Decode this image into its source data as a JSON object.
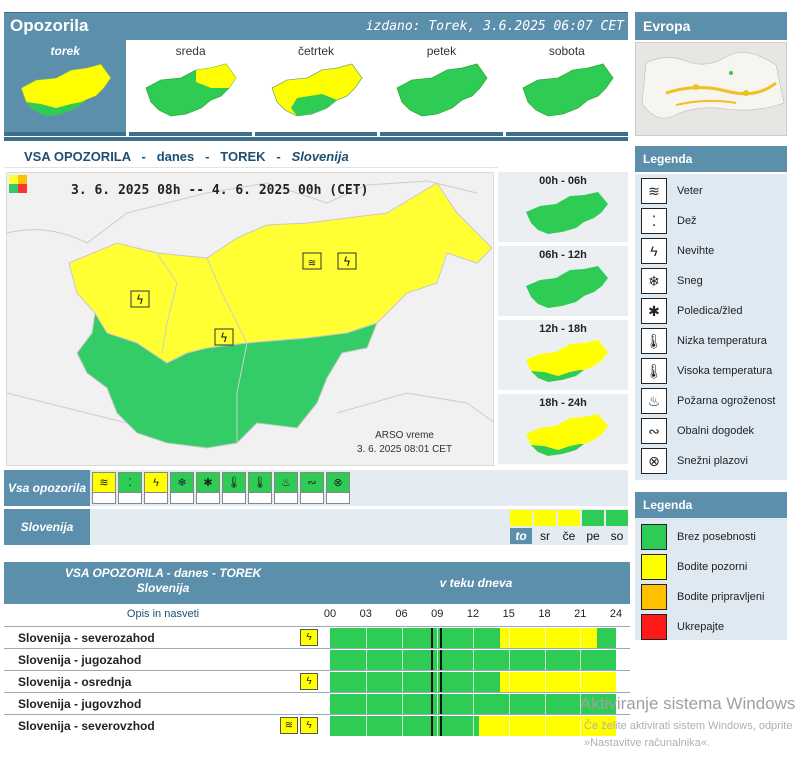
{
  "header": {
    "title": "Opozorila",
    "issued": "izdano: Torek, 3.6.2025 06:07 CET"
  },
  "days": [
    {
      "name": "torek",
      "active": true
    },
    {
      "name": "sreda",
      "active": false
    },
    {
      "name": "četrtek",
      "active": false
    },
    {
      "name": "petek",
      "active": false
    },
    {
      "name": "sobota",
      "active": false
    }
  ],
  "europe": {
    "title": "Evropa"
  },
  "section": {
    "part1": "VSA OPOZORILA",
    "dash": "-",
    "part2": "danes",
    "part3": "TOREK",
    "part4": "Slovenija"
  },
  "map": {
    "daterange": "3. 6. 2025  08h  --  4. 6. 2025  00h   (CET)",
    "credit_line1": "ARSO vreme",
    "credit_line2": "3. 6. 2025  08:01  CET"
  },
  "slots": [
    {
      "label": "00h - 06h"
    },
    {
      "label": "06h - 12h"
    },
    {
      "label": "12h - 18h"
    },
    {
      "label": "18h - 24h"
    }
  ],
  "legend1": {
    "title": "Legenda",
    "items": [
      {
        "label": "Veter",
        "icon": "wind-icon",
        "glyph": "≋"
      },
      {
        "label": "Dež",
        "icon": "rain-icon",
        "glyph": "⁚"
      },
      {
        "label": "Nevihte",
        "icon": "thunderstorm-icon",
        "glyph": "ϟ"
      },
      {
        "label": "Sneg",
        "icon": "snow-icon",
        "glyph": "❄"
      },
      {
        "label": "Poledica/žled",
        "icon": "ice-icon",
        "glyph": "✱"
      },
      {
        "label": "Nizka temperatura",
        "icon": "low-temp-icon",
        "glyph": "🌡"
      },
      {
        "label": "Visoka temperatura",
        "icon": "high-temp-icon",
        "glyph": "🌡"
      },
      {
        "label": "Požarna ogroženost",
        "icon": "fire-icon",
        "glyph": "♨"
      },
      {
        "label": "Obalni dogodek",
        "icon": "coastal-icon",
        "glyph": "∾"
      },
      {
        "label": "Snežni plazovi",
        "icon": "avalanche-icon",
        "glyph": "⊗"
      }
    ]
  },
  "legend2": {
    "title": "Legenda",
    "items": [
      {
        "label": "Brez posebnosti",
        "color": "#2ecc55"
      },
      {
        "label": "Bodite pozorni",
        "color": "#ffff00"
      },
      {
        "label": "Bodite pripravljeni",
        "color": "#ffc000"
      },
      {
        "label": "Ukrepajte",
        "color": "#ff1a1a"
      }
    ]
  },
  "filters": {
    "row1_label": "Vsa opozorila",
    "row2_label": "Slovenija",
    "icons": [
      "wind-icon",
      "rain-icon",
      "thunderstorm-icon",
      "snow-icon",
      "ice-icon",
      "low-temp-icon",
      "high-temp-icon",
      "fire-icon",
      "coastal-icon",
      "avalanche-icon"
    ],
    "day_abbr": [
      "to",
      "sr",
      "če",
      "pe",
      "so"
    ],
    "day_levels": [
      "yellow",
      "yellow",
      "yellow",
      "green",
      "green"
    ]
  },
  "table": {
    "head_line1": "VSA OPOZORILA - danes - TOREK",
    "head_line2": "Slovenija",
    "head_right": "v teku dneva",
    "sub_left": "Opis in nasveti",
    "hours": [
      "00",
      "03",
      "06",
      "09",
      "12",
      "15",
      "18",
      "21",
      "24"
    ],
    "rows": [
      {
        "name": "Slovenija - severozahod",
        "icons": [
          "thunderstorm-icon"
        ],
        "yellow_from": 14.3,
        "yellow_to": 22.4
      },
      {
        "name": "Slovenija - jugozahod",
        "icons": [],
        "yellow_from": null,
        "yellow_to": null
      },
      {
        "name": "Slovenija - osrednja",
        "icons": [
          "thunderstorm-icon"
        ],
        "yellow_from": 14.3,
        "yellow_to": 24
      },
      {
        "name": "Slovenija - jugovzhod",
        "icons": [],
        "yellow_from": null,
        "yellow_to": null
      },
      {
        "name": "Slovenija - severovzhod",
        "icons": [
          "wind-icon",
          "thunderstorm-icon"
        ],
        "yellow_from": 12.5,
        "yellow_to": 24
      }
    ]
  },
  "watermark": {
    "line1": "Aktiviranje sistema Windows",
    "line2": "Če želite aktivirati sistem Windows, odprite",
    "line3": "»Nastavitve računalnika«."
  }
}
